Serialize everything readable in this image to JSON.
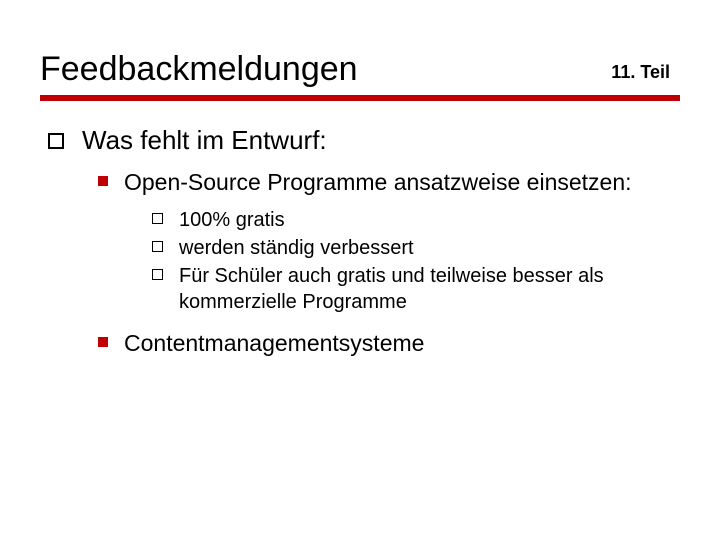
{
  "header": {
    "title": "Feedbackmeldungen",
    "part": "11. Teil"
  },
  "content": {
    "lvl1": {
      "text": "Was fehlt im Entwurf:"
    },
    "lvl2a": {
      "text": "Open-Source Programme ansatzweise einsetzen:"
    },
    "lvl3": [
      "100% gratis",
      "werden ständig verbessert",
      "Für Schüler auch gratis und teilweise besser als kommerzielle Programme"
    ],
    "lvl2b": {
      "text": "Contentmanagementsysteme"
    }
  }
}
